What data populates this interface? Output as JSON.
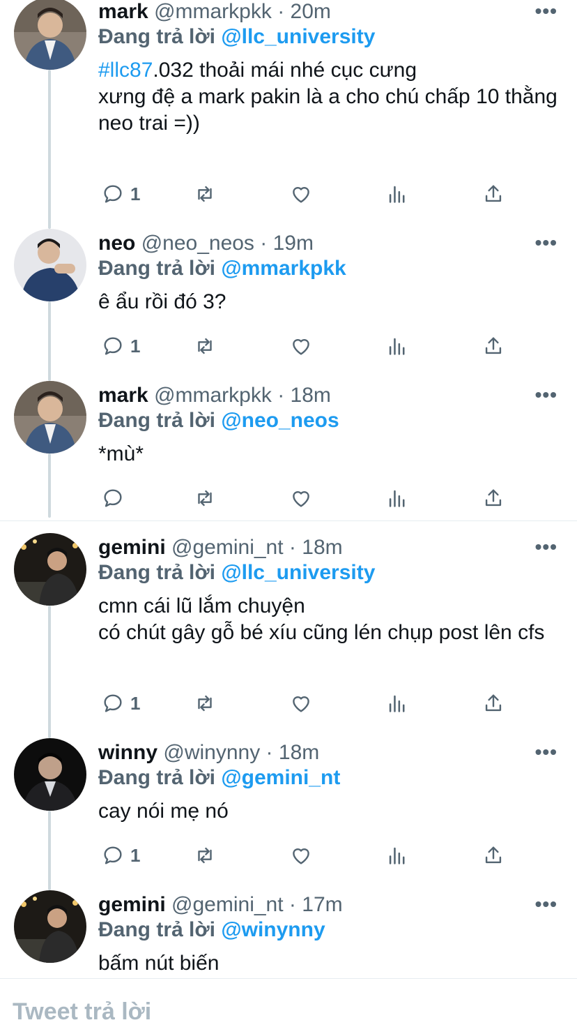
{
  "tweets": [
    {
      "name": "mark",
      "handle": "@mmarkpkk",
      "dot": "·",
      "time": "20m",
      "reply_prefix": "Đang trả lời",
      "reply_mention": "@llc_university",
      "hashtag": "#llc87",
      "text": ".032 thoải mái nhé cục cưng\nxưng đệ a mark pakin là a cho chú chấp 10 thằng neo trai =))",
      "reply_count": "1",
      "more": "•••"
    },
    {
      "name": "neo",
      "handle": "@neo_neos",
      "dot": "·",
      "time": "19m",
      "reply_prefix": "Đang trả lời",
      "reply_mention": "@mmarkpkk",
      "text": "ê ẩu rồi đó 3?",
      "reply_count": "1",
      "more": "•••"
    },
    {
      "name": "mark",
      "handle": "@mmarkpkk",
      "dot": "·",
      "time": "18m",
      "reply_prefix": "Đang trả lời",
      "reply_mention": "@neo_neos",
      "text": "*mù*",
      "reply_count": "",
      "more": "•••"
    },
    {
      "name": "gemini",
      "handle": "@gemini_nt",
      "dot": "·",
      "time": "18m",
      "reply_prefix": "Đang trả lời",
      "reply_mention": "@llc_university",
      "text": "cmn cái lũ lắm chuyện\ncó chút gây gỗ bé xíu cũng lén chụp post lên cfs",
      "reply_count": "1",
      "more": "•••"
    },
    {
      "name": "winny",
      "handle": "@winynny",
      "dot": "·",
      "time": "18m",
      "reply_prefix": "Đang trả lời",
      "reply_mention": "@gemini_nt",
      "text": "cay nói mẹ nó",
      "reply_count": "1",
      "more": "•••"
    },
    {
      "name": "gemini",
      "handle": "@gemini_nt",
      "dot": "·",
      "time": "17m",
      "reply_prefix": "Đang trả lời",
      "reply_mention": "@winynny",
      "text": "bấm nút biến",
      "reply_count": "",
      "more": "•••"
    }
  ],
  "compose": {
    "placeholder": "Tweet trả lời"
  },
  "icons": {
    "reply": "reply-icon",
    "retweet": "retweet-icon",
    "like": "heart-icon",
    "analytics": "analytics-icon",
    "share": "share-icon",
    "more": "more-icon"
  },
  "colors": {
    "accent": "#1d9bf0",
    "secondary": "#536471",
    "icon": "#536471"
  }
}
